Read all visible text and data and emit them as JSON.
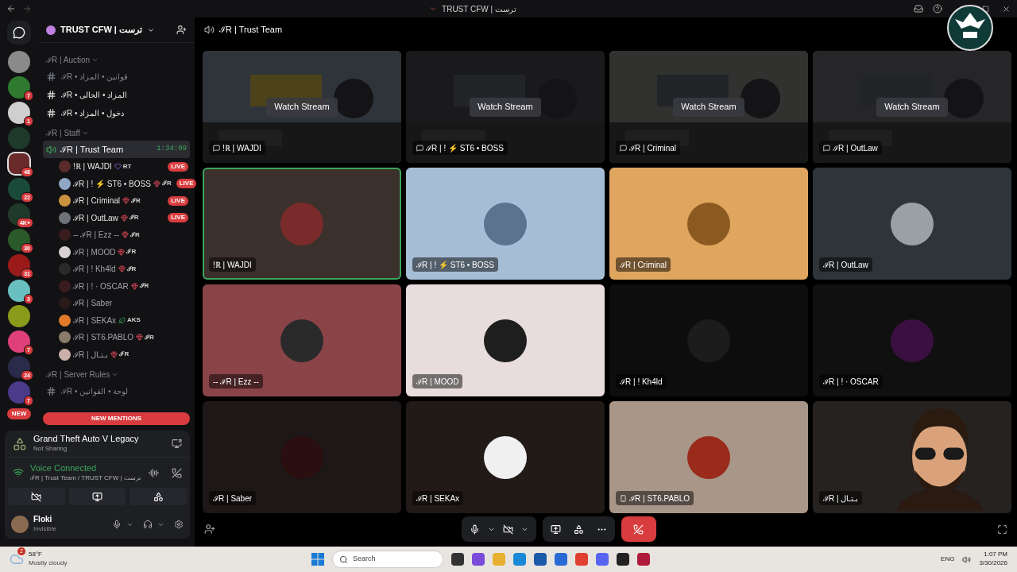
{
  "window": {
    "title": "TRUST CFW | ترست"
  },
  "servers": [
    {
      "selected": false
    },
    {
      "badge": "7",
      "selected": false
    },
    {
      "badge": "1",
      "selected": false
    },
    {
      "selected": false
    },
    {
      "badge": "48",
      "selected": true
    },
    {
      "badge": "22",
      "selected": false
    },
    {
      "badge": "4K+",
      "selected": false
    },
    {
      "badge": "30",
      "selected": false
    },
    {
      "badge": "31",
      "selected": false
    },
    {
      "badge": "3",
      "selected": false
    },
    {
      "selected": false
    },
    {
      "badge": "7",
      "selected": false
    },
    {
      "badge": "24",
      "selected": false
    },
    {
      "badge": "7",
      "selected": false
    }
  ],
  "new_pill": "NEW",
  "server_name": "TRUST CFW | ترست",
  "sidebar": [
    {
      "kind": "category",
      "label": "ℐR | Auction"
    },
    {
      "kind": "text",
      "label": "ℐR • قوانين • المزاد",
      "unread": false
    },
    {
      "kind": "text",
      "label": "ℐR • المزاد • الحالى",
      "unread": true
    },
    {
      "kind": "text",
      "label": "ℐR • دخول • المزاد",
      "unread": true
    },
    {
      "kind": "category",
      "label": "ℐR | Staff"
    },
    {
      "kind": "voice",
      "label": "ℐR | Trust Team",
      "timer": "1:34:09",
      "selected": true,
      "members": [
        {
          "name": "!ℝ | WAJDI",
          "badge": {
            "kind": "heart",
            "text": "RT"
          },
          "live": true,
          "live_badge": "LIVE",
          "color": "#5a2b2b"
        },
        {
          "name": "ℐR | ! ⚡ ST6 • BOSS",
          "badge": {
            "kind": "gem",
            "text": "ℐR"
          },
          "live": true,
          "live_badge": "LIVE",
          "color": "#8fa7c4"
        },
        {
          "name": "ℐR | Criminal",
          "badge": {
            "kind": "gem",
            "text": "ℐR"
          },
          "live": true,
          "live_badge": "LIVE",
          "color": "#c9923f"
        },
        {
          "name": "ℐR | OutLaw",
          "badge": {
            "kind": "gem",
            "text": "ℐR"
          },
          "live": true,
          "live_badge": "LIVE",
          "color": "#6d7378"
        },
        {
          "name": "-- ℐR | Ezz --",
          "badge": {
            "kind": "gem",
            "text": "ℐR"
          },
          "live": false,
          "color": "#3a1c1e"
        },
        {
          "name": "ℐR | MOOD",
          "badge": {
            "kind": "gem",
            "text": "ℐR"
          },
          "live": false,
          "color": "#d9d2d2"
        },
        {
          "name": "ℐR | ! Kh4ld",
          "badge": {
            "kind": "gem",
            "text": "ℐR"
          },
          "live": false,
          "color": "#2a2a2a"
        },
        {
          "name": "ℐR | ! · OSCAR",
          "badge": {
            "kind": "gem",
            "text": "ℐR"
          },
          "live": false,
          "color": "#3a1c1e"
        },
        {
          "name": "ℐR | Saber",
          "live": false,
          "color": "#2a1a1a"
        },
        {
          "name": "ℐR | SEKAx",
          "badge": {
            "kind": "leaf",
            "text": "AKS"
          },
          "live": false,
          "color": "#e07a2a"
        },
        {
          "name": "ℐR | ST6.PABLO",
          "badge": {
            "kind": "gem",
            "text": "ℐR"
          },
          "live": false,
          "color": "#8a7a6a"
        },
        {
          "name": "ℐR | بـتـال",
          "badge": {
            "kind": "gem",
            "text": "ℐR"
          },
          "live": false,
          "color": "#c9b0a8"
        }
      ]
    },
    {
      "kind": "category",
      "label": "ℐR | Server Rules"
    },
    {
      "kind": "text",
      "label": "ℐR • لوحة • القوانين",
      "unread": false
    }
  ],
  "new_mentions": "NEW MENTIONS",
  "activity": {
    "game": "Grand Theft Auto V Legacy",
    "status": "Not Sharing"
  },
  "voice": {
    "status": "Voice Connected",
    "channel": "ℐR | Trust Team / TRUST CFW | ترست"
  },
  "user": {
    "name": "Floki",
    "status": "Invisible"
  },
  "channel_header": "ℐR | Trust Team",
  "tiles": [
    {
      "kind": "stream",
      "name": "!ℝ | WAJDI",
      "action": "Watch Stream",
      "color": "#3a3f44",
      "speaking": false
    },
    {
      "kind": "stream",
      "name": "ℐR | ! ⚡ ST6 • BOSS",
      "action": "Watch Stream",
      "color": "#2a2a2c",
      "speaking": false
    },
    {
      "kind": "stream",
      "name": "ℐR | Criminal",
      "action": "Watch Stream",
      "color": "#4a4a48",
      "speaking": false
    },
    {
      "kind": "stream",
      "name": "ℐR | OutLaw",
      "action": "Watch Stream",
      "color": "#3c3c40",
      "speaking": false
    },
    {
      "kind": "user",
      "name": "!ℝ | WAJDI",
      "color": "#3b302c",
      "avatar": {
        "color": "#7a2a2a"
      },
      "speaking": true
    },
    {
      "kind": "user",
      "name": "ℐR | ! ⚡ ST6 • BOSS",
      "color": "#a6bdd6",
      "avatar": {
        "color": "#5c7390"
      },
      "speaking": false
    },
    {
      "kind": "user",
      "name": "ℐR | Criminal",
      "color": "#e0a55e",
      "avatar": {
        "color": "#8a5a20"
      },
      "speaking": false
    },
    {
      "kind": "user",
      "name": "ℐR | OutLaw",
      "color": "#2e3438",
      "avatar": {
        "color": "#9aa0a4"
      },
      "speaking": false
    },
    {
      "kind": "user",
      "name": "-- ℐR | Ezz --",
      "color": "#8a4448",
      "avatar": {
        "color": "#2a2a2a"
      },
      "speaking": false
    },
    {
      "kind": "user",
      "name": "ℐR | MOOD",
      "color": "#e8dcdc",
      "avatar": {
        "color": "#1e1e1e"
      },
      "speaking": false
    },
    {
      "kind": "user",
      "name": "ℐR | ! Kh4ld",
      "color": "#0d0d0d",
      "avatar": {
        "color": "#1c1c1c"
      },
      "speaking": false
    },
    {
      "kind": "user",
      "name": "ℐR | ! · OSCAR",
      "color": "#101010",
      "avatar": {
        "color": "#3a1040"
      },
      "speaking": false
    },
    {
      "kind": "user",
      "name": "ℐR | Saber",
      "color": "#1e1717",
      "avatar": {
        "color": "#2a0e10"
      },
      "speaking": false
    },
    {
      "kind": "user",
      "name": "ℐR | SEKAx",
      "color": "#221a17",
      "avatar": {
        "color": "#f0f0f0"
      },
      "speaking": false
    },
    {
      "kind": "user",
      "name": "ℐR | ST6.PABLO",
      "color": "#a89688",
      "avatar": {
        "color": "#9a2a1a"
      },
      "speaking": false,
      "mobile": true
    },
    {
      "kind": "user",
      "name": "ℐR | بـتـال",
      "color": "#262220",
      "speaking": false,
      "overlay": true
    }
  ],
  "taskbar": {
    "weather_badge": "2",
    "temp": "58°F",
    "weather": "Mostly cloudy",
    "search": "Search",
    "lang": "ENG",
    "time": "1:07 PM",
    "date": "3/30/2026"
  }
}
